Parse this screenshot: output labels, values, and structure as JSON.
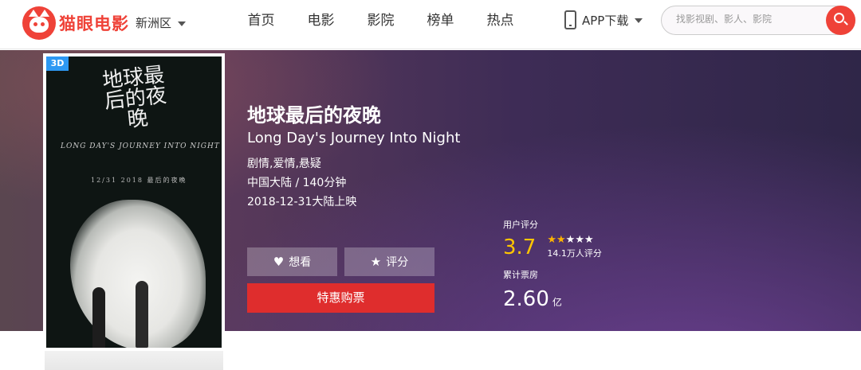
{
  "header": {
    "logo_text": "猫眼电影",
    "city": "新洲区",
    "nav": [
      "首页",
      "电影",
      "影院",
      "榜单",
      "热点"
    ],
    "app_download": "APP下载",
    "search_placeholder": "找影视剧、影人、影院"
  },
  "movie": {
    "badge": "3D",
    "title_cn": "地球最后的夜晚",
    "title_en": "Long Day's Journey Into Night",
    "genres": "剧情,爱情,悬疑",
    "region_duration": "中国大陆 / 140分钟",
    "release": "2018-12-31大陆上映",
    "poster": {
      "title": "地球最后的夜晚",
      "english": "LONG DAY'S JOURNEY INTO NIGHT",
      "date": "12/31 2018 最后的夜晚"
    }
  },
  "actions": {
    "want": "想看",
    "rate": "评分",
    "buy": "特惠购票"
  },
  "stats": {
    "user_rating_label": "用户评分",
    "score": "3.7",
    "stars_filled": 2,
    "stars_total": 5,
    "rating_count": "14.1万人评分",
    "box_office_label": "累计票房",
    "box_office_value": "2.60",
    "box_office_unit": "亿"
  },
  "colors": {
    "brand_red": "#ef4238",
    "buy_button": "#df2d2d",
    "score": "#ffc600",
    "badge_3d": "#2d98f3"
  }
}
